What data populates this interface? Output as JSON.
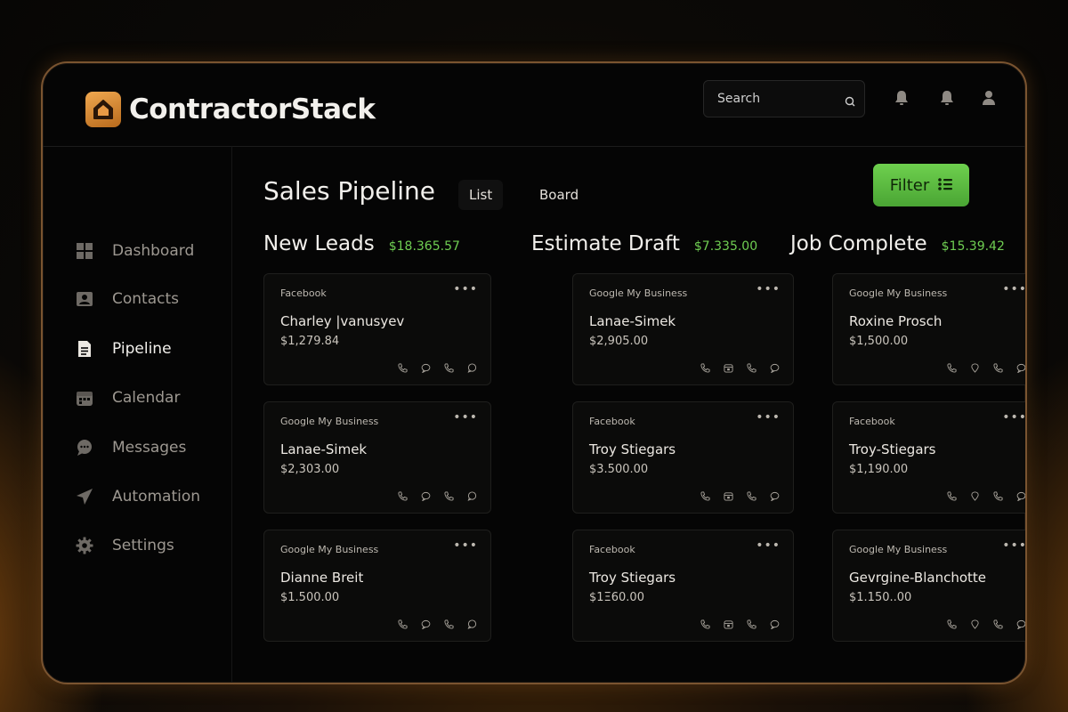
{
  "app": {
    "brand": "ContractorStack"
  },
  "header": {
    "search_placeholder": "Search"
  },
  "sidebar": {
    "items": [
      {
        "label": "Dashboard",
        "icon": "grid-icon",
        "active": false
      },
      {
        "label": "Contacts",
        "icon": "contact-card-icon",
        "active": false
      },
      {
        "label": "Pipeline",
        "icon": "document-icon",
        "active": true
      },
      {
        "label": "Calendar",
        "icon": "calendar-icon",
        "active": false
      },
      {
        "label": "Messages",
        "icon": "chat-bubble-icon",
        "active": false
      },
      {
        "label": "Automation",
        "icon": "paper-plane-icon",
        "active": false
      },
      {
        "label": "Settings",
        "icon": "gear-icon",
        "active": false
      }
    ]
  },
  "main": {
    "title": "Sales Pipeline",
    "tabs": [
      {
        "label": "List",
        "active": true
      },
      {
        "label": "Board",
        "active": false
      }
    ],
    "filter_label": "Filter",
    "columns": [
      {
        "title": "New Leads",
        "total": "$18.365.57",
        "cards": [
          {
            "source": "Facebook",
            "name": "Charley |vanusyev",
            "amount": "$1,279.84"
          },
          {
            "source": "Google My Business",
            "name": "Lanae-Simek",
            "amount": "$2,303.00"
          },
          {
            "source": "Google My Business",
            "name": "Dianne Breit",
            "amount": "$1.500.00"
          }
        ]
      },
      {
        "title": "Estimate Draft",
        "total": "$7.335.00",
        "cards": [
          {
            "source": "Google My Business",
            "name": "Lanae-Simek",
            "amount": "$2,905.00"
          },
          {
            "source": "Facebook",
            "name": "Troy Stiegars",
            "amount": "$3.500.00"
          },
          {
            "source": "Facebook",
            "name": "Troy Stiegars",
            "amount": "$1Ξ60.00"
          }
        ]
      },
      {
        "title": "Job Complete",
        "total": "$15.39.42",
        "cards": [
          {
            "source": "Google My Business",
            "name": "Roxine Prosch",
            "amount": "$1,500.00"
          },
          {
            "source": "Facebook",
            "name": "Troy-Stiegars",
            "amount": "$1,190.00"
          },
          {
            "source": "Google My Business",
            "name": "Gevrgine-Blanchotte",
            "amount": "$1.150..00"
          }
        ]
      }
    ]
  },
  "colors": {
    "accent_green": "#5cbf40",
    "total_green": "#6fce52",
    "frame_bronze": "#7a5430",
    "logo_orange": "#e08a30"
  }
}
